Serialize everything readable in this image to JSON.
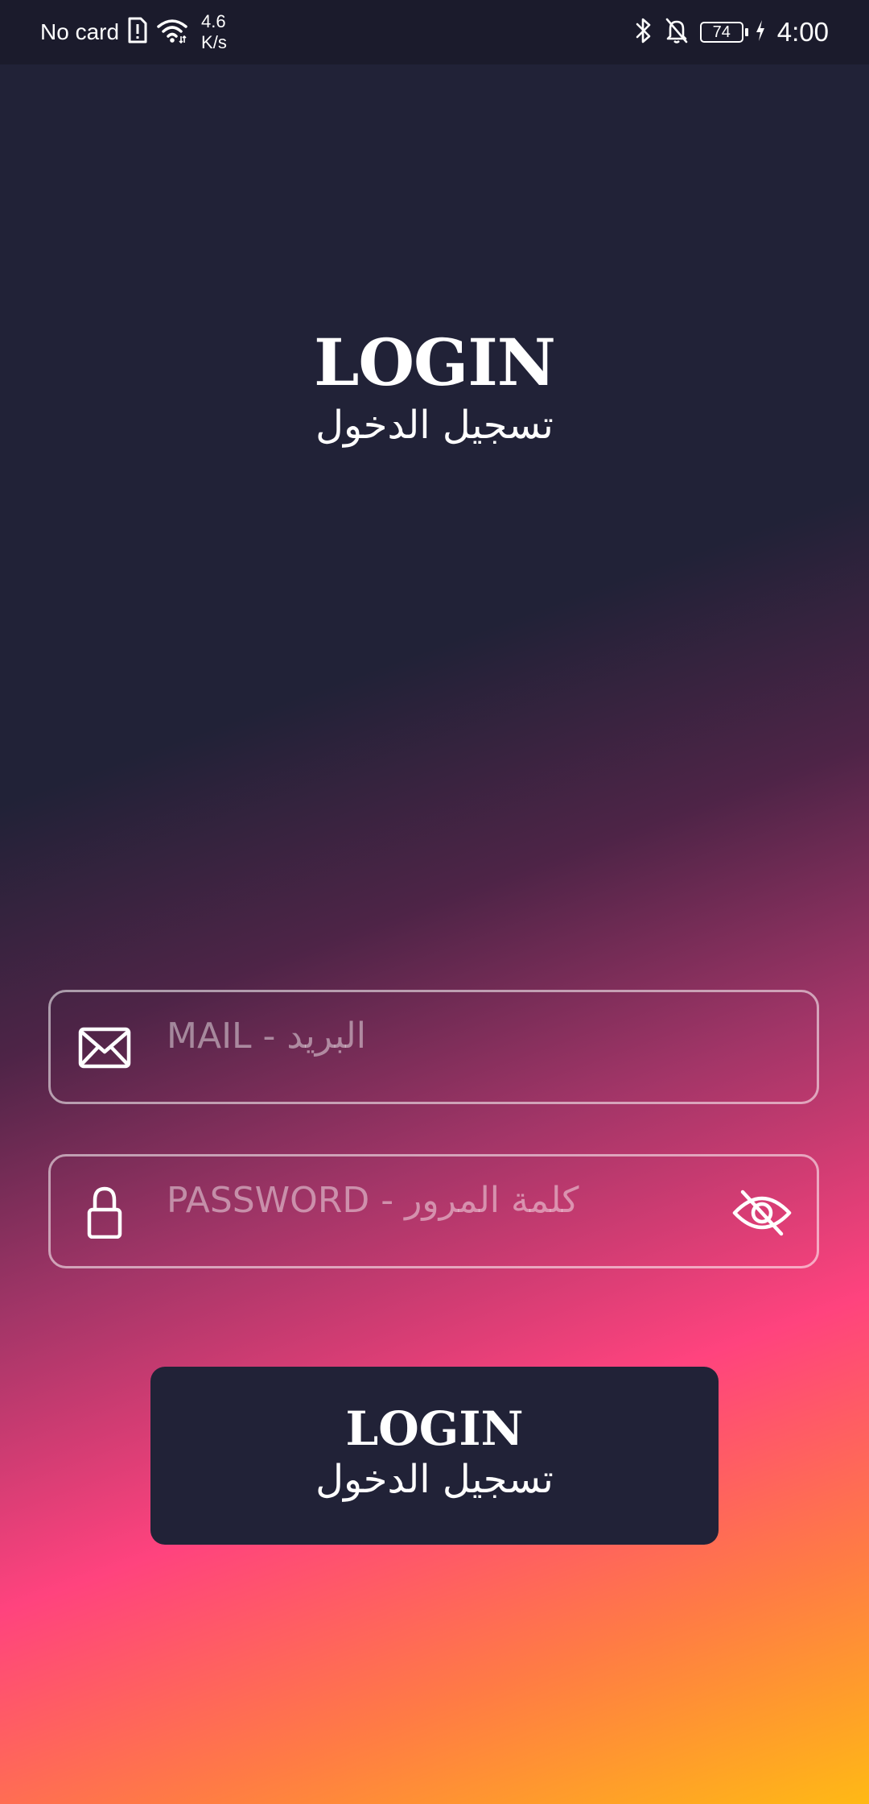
{
  "status_bar": {
    "carrier": "No card",
    "speed_value": "4.6",
    "speed_unit": "K/s",
    "battery": "74",
    "time": "4:00",
    "icons": [
      "sim-alert-icon",
      "wifi-icon",
      "bluetooth-icon",
      "bell-off-icon",
      "battery-icon",
      "charging-icon"
    ]
  },
  "header": {
    "title_en": "LOGIN",
    "title_ar": "تسجيل الدخول"
  },
  "form": {
    "email": {
      "placeholder": "MAIL - البريد",
      "value": "",
      "icon": "mail-icon"
    },
    "password": {
      "placeholder": "PASSWORD - كلمة المرور",
      "value": "",
      "icon": "lock-icon",
      "toggle_icon": "eye-off-icon"
    }
  },
  "login_button": {
    "label_en": "LOGIN",
    "label_ar": "تسجيل الدخول"
  },
  "colors": {
    "background_top": "#212237",
    "background_mid": "#ff437e",
    "background_bottom": "#ffb915",
    "button": "#212237",
    "text": "#ffffff"
  }
}
